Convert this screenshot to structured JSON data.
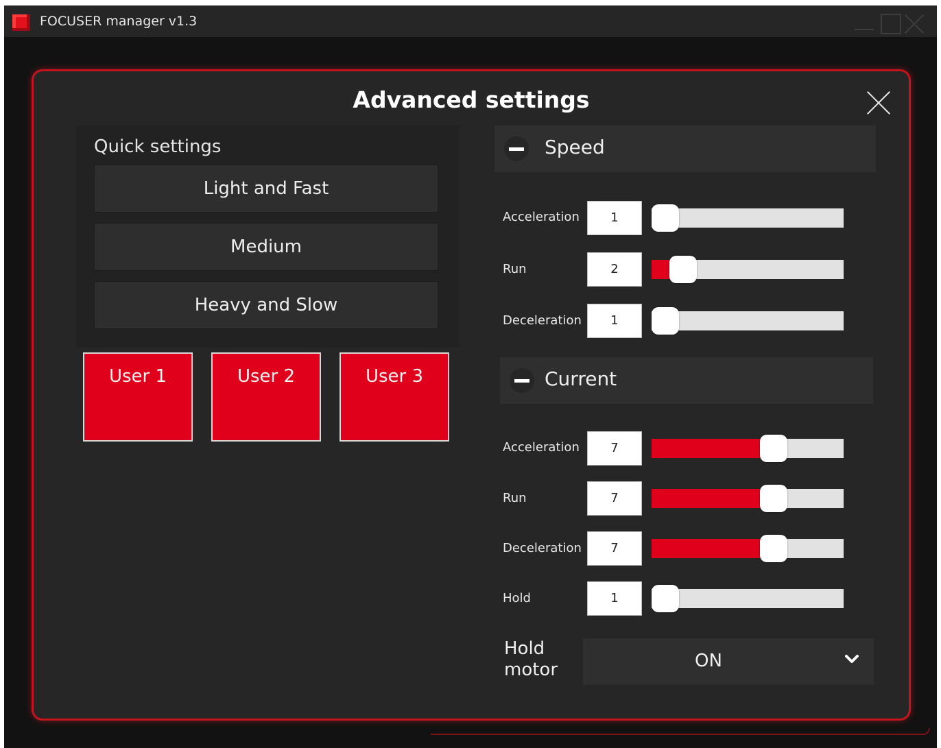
{
  "window": {
    "title": "FOCUSER manager v1.3"
  },
  "dialog": {
    "title": "Advanced settings"
  },
  "quick_settings": {
    "title": "Quick settings",
    "presets": [
      "Light and Fast",
      "Medium",
      "Heavy and Slow"
    ],
    "user_buttons": [
      "User 1",
      "User 2",
      "User 3"
    ]
  },
  "speed": {
    "header": "Speed",
    "rows": [
      {
        "label": "Acceleration",
        "value": "1",
        "fraction": 0.0
      },
      {
        "label": "Run",
        "value": "2",
        "fraction": 0.11
      },
      {
        "label": "Deceleration",
        "value": "1",
        "fraction": 0.0
      }
    ]
  },
  "current": {
    "header": "Current",
    "rows": [
      {
        "label": "Acceleration",
        "value": "7",
        "fraction": 0.66
      },
      {
        "label": "Run",
        "value": "7",
        "fraction": 0.66
      },
      {
        "label": "Deceleration",
        "value": "7",
        "fraction": 0.66
      },
      {
        "label": "Hold",
        "value": "1",
        "fraction": 0.0
      }
    ]
  },
  "hold_motor": {
    "label": "Hold motor",
    "selected": "ON"
  },
  "colors": {
    "accent": "#e0001b",
    "dialog_border": "#c5141e",
    "panel": "#262626"
  },
  "icons": {
    "app": "app-icon",
    "collapse": "minus-circle-icon",
    "close": "close-icon",
    "dropdown": "chevron-down-icon"
  }
}
